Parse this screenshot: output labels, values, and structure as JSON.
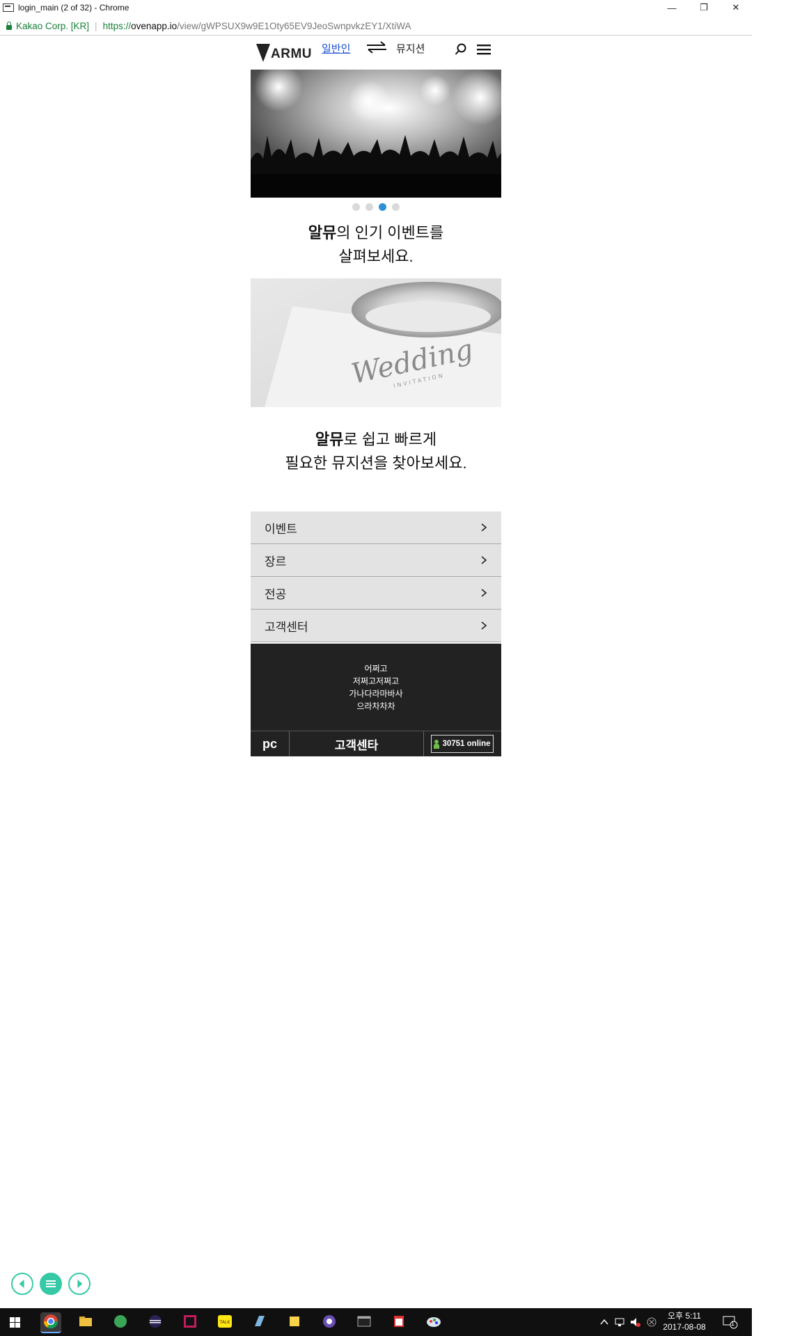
{
  "window": {
    "title": "login_main (2 of 32) - Chrome",
    "org": "Kakao Corp. [KR]",
    "url_scheme": "https://",
    "url_host": "ovenapp.io",
    "url_path": "/view/gWPSUX9w9E1Oty65EV9JeoSwnpvkzEY1/XtiWA"
  },
  "header": {
    "logo_text": "ARMU",
    "nav_general": "일반인",
    "nav_musician": "뮤지션"
  },
  "carousel": {
    "total": 4,
    "active_index": 2
  },
  "headline1": {
    "brand": "알뮤",
    "line1_rest": "의 인기 이벤트를",
    "line2": "살펴보세요."
  },
  "banner2": {
    "text": "Wedding",
    "subtext": "INVITATION"
  },
  "headline2": {
    "brand": "알뮤",
    "line1_rest": "로 쉽고 빠르게",
    "line2": "필요한 뮤지션을 찾아보세요."
  },
  "menu": [
    {
      "label": "이벤트"
    },
    {
      "label": "장르"
    },
    {
      "label": "전공"
    },
    {
      "label": "고객센터"
    }
  ],
  "footer": {
    "lines": [
      "어쩌고",
      "저쩌고저쩌고",
      "가나다라마바사",
      "으라차차차"
    ],
    "pc_label": "pc",
    "cs_label": "고객센타",
    "online_text": "30751 online"
  },
  "taskbar": {
    "time": "오후 5:11",
    "date": "2017-08-08",
    "notification_count": "1"
  },
  "colors": {
    "accent_link": "#1a4fd6",
    "dot_active": "#2f8fd6",
    "viewer_teal": "#37c9a6",
    "online_green": "#6cc04a"
  }
}
